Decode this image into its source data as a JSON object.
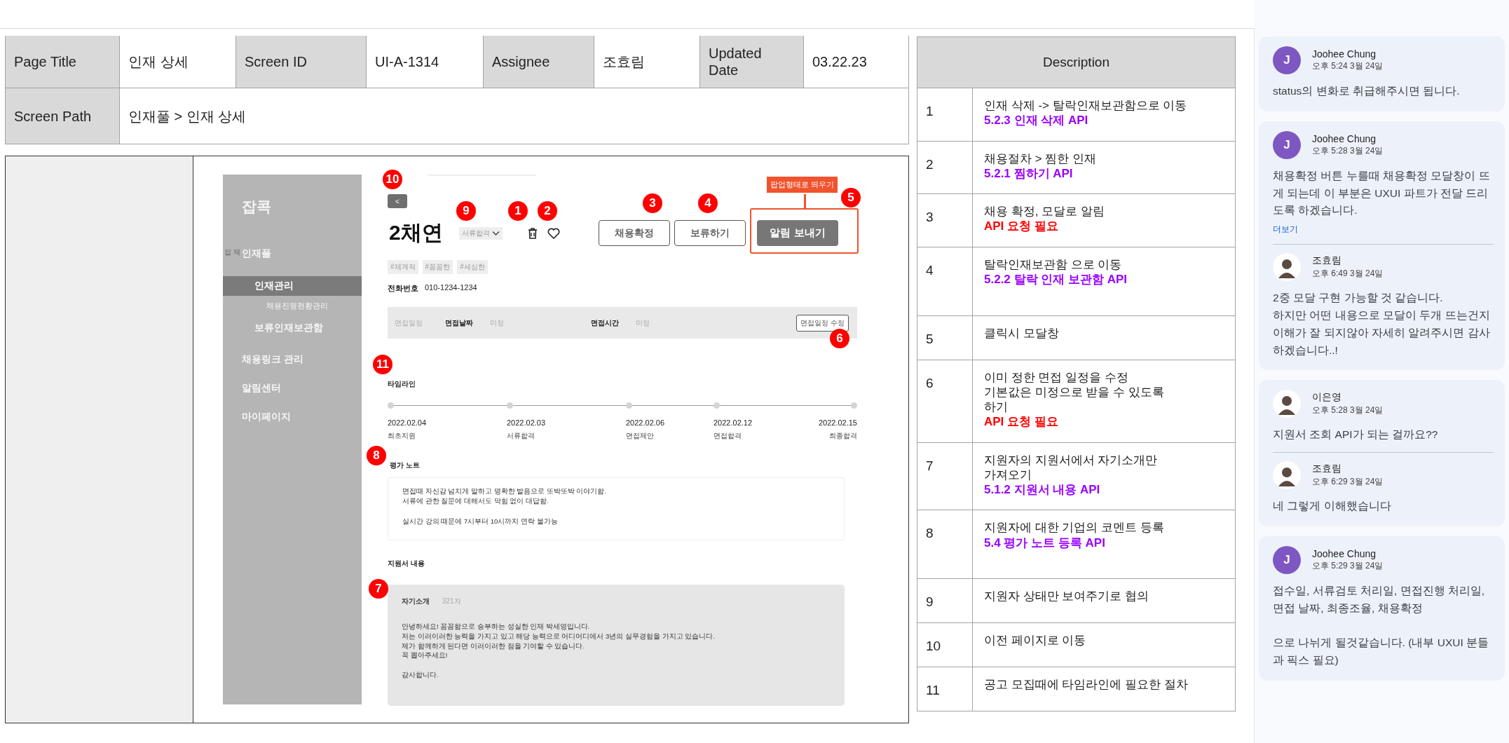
{
  "header": {
    "rows": [
      [
        {
          "label": "Page Title",
          "value": "인재 상세"
        },
        {
          "label": "Screen ID",
          "value": "UI-A-1314"
        },
        {
          "label": "Assignee",
          "value": "조효림"
        },
        {
          "label": "Updated Date",
          "value": "03.22.23"
        }
      ],
      [
        {
          "label": "Screen Path",
          "value": "인재풀 > 인재 상세"
        }
      ]
    ]
  },
  "wireframe": {
    "sidebar": {
      "logo": "잡콕",
      "ghost_text": "접 제",
      "items": [
        {
          "label": "인재풀",
          "selected": false,
          "children": [
            {
              "label": "인재관리",
              "selected": true,
              "children": [
                {
                  "label": "채용진행현황관리",
                  "selected": false
                }
              ]
            },
            {
              "label": "보류인재보관함",
              "selected": false
            }
          ]
        },
        {
          "label": "채용링크 관리",
          "selected": false
        },
        {
          "label": "알림센터",
          "selected": false
        },
        {
          "label": "마이페이지",
          "selected": false
        }
      ]
    },
    "back_button": "<",
    "name": "2채연",
    "status": "서류합격",
    "buttons": [
      {
        "label": "채용확정",
        "kind": "outline"
      },
      {
        "label": "보류하기",
        "kind": "outline"
      },
      {
        "label": "알림 보내기",
        "kind": "filled",
        "annotation": "팝업형태로 띄우기"
      }
    ],
    "tags": [
      "#체계적",
      "#꼼꼼한",
      "#세심한"
    ],
    "phone": {
      "label": "전화번호",
      "value": "010-1234-1234"
    },
    "interview": {
      "title": "면접일정",
      "fields": [
        {
          "label": "면접날짜",
          "value": "미정"
        },
        {
          "label": "면접시간",
          "value": "미정"
        }
      ],
      "edit_button": "면접일정 수정"
    },
    "timeline": {
      "title": "타임라인",
      "steps": [
        {
          "date": "2022.02.04",
          "label": "최초지원"
        },
        {
          "date": "2022.02.03",
          "label": "서류합격"
        },
        {
          "date": "2022.02.06",
          "label": "면접제안"
        },
        {
          "date": "2022.02.12",
          "label": "면접합격"
        },
        {
          "date": "2022.02.15",
          "label": "최종합격"
        }
      ]
    },
    "note": {
      "title": "평가 노트",
      "text": "면접때 자신감 넘치게 말하고 명확한 발음으로 또박또박 이야기함.\n서류에 관한 질문에 대해서도 막힘 없이 대답함.\n\n실시간 강의 때문에 7시부터 10시까지 연락 불가능"
    },
    "application": {
      "title": "지원서 내용",
      "section": "자기소개",
      "count": "321자",
      "text": "안녕하세요! 꼼꼼함으로 승부하는 성실한 인재 박세영입니다.\n저는 이러이러한 능력을 가지고 있고 해당 능력으로 어디어디에서 3년의 실무경험을 가지고 있습니다.\n제가 함께하게 된다면 이러이러한 점을 기여할 수 있습니다.\n꼭 뽑아주세요!\n\n감사합니다."
    },
    "markers": [
      "10",
      "9",
      "1",
      "2",
      "3",
      "4",
      "5",
      "6",
      "11",
      "8",
      "7"
    ]
  },
  "description": {
    "title": "Description",
    "rows": [
      {
        "number": "1",
        "lines": [
          {
            "kind": "plain",
            "text": "인재 삭제 -> 탈락인재보관함으로 이동"
          },
          {
            "kind": "api",
            "text": "5.2.3 인재 삭제 API"
          }
        ]
      },
      {
        "number": "2",
        "lines": [
          {
            "kind": "plain",
            "text": "채용절차 > 찜한 인재"
          },
          {
            "kind": "api",
            "text": "5.2.1 찜하기 API"
          }
        ]
      },
      {
        "number": "3",
        "lines": [
          {
            "kind": "plain",
            "text": "채용 확정, 모달로 알림"
          },
          {
            "kind": "request",
            "text": "API 요청 필요"
          }
        ]
      },
      {
        "number": "4",
        "lines": [
          {
            "kind": "plain",
            "text": "탈락인재보관함 으로 이동"
          },
          {
            "kind": "api",
            "text": "5.2.2 탈락 인재 보관함 API"
          }
        ]
      },
      {
        "number": "5",
        "lines": [
          {
            "kind": "plain",
            "text": "클릭시 모달창"
          }
        ]
      },
      {
        "number": "6",
        "lines": [
          {
            "kind": "plain",
            "text": "이미 정한 면접 일정을 수정"
          },
          {
            "kind": "plain",
            "text": "기본값은 미정으로 받을 수 있도록"
          },
          {
            "kind": "plain",
            "text": "하기"
          },
          {
            "kind": "request",
            "text": "API 요청 필요"
          }
        ]
      },
      {
        "number": "7",
        "lines": [
          {
            "kind": "plain",
            "text": "지원자의 지원서에서 자기소개만"
          },
          {
            "kind": "plain",
            "text": "가져오기"
          },
          {
            "kind": "api",
            "text": "5.1.2 지원서 내용 API"
          }
        ]
      },
      {
        "number": "8",
        "lines": [
          {
            "kind": "plain",
            "text": "지원자에 대한 기업의 코멘트 등록"
          },
          {
            "kind": "api",
            "text": "5.4 평가 노트 등록 API"
          }
        ]
      },
      {
        "number": "9",
        "lines": [
          {
            "kind": "plain",
            "text": "지원자 상태만 보여주기로 협의"
          }
        ]
      },
      {
        "number": "10",
        "lines": [
          {
            "kind": "plain",
            "text": "이전 페이지로 이동"
          }
        ]
      },
      {
        "number": "11",
        "lines": [
          {
            "kind": "plain",
            "text": "공고 모집때에 타임라인에 필요한 절차"
          }
        ]
      }
    ]
  },
  "comments": [
    {
      "items": [
        {
          "author": "Joohee Chung",
          "avatar": {
            "kind": "letter",
            "letter": "J"
          },
          "time": "오후 5:24 3월 24일",
          "text": "status의 변화로 취급해주시면 됩니다."
        }
      ]
    },
    {
      "items": [
        {
          "author": "Joohee Chung",
          "avatar": {
            "kind": "letter",
            "letter": "J"
          },
          "time": "오후 5:28 3월 24일",
          "text": "채용확정 버튼 누를때 채용확정 모달창이 뜨게 되는데 이 부분은  UXUI 파트가 전달 드리도록 하겠습니다.",
          "more": "더보기"
        },
        {
          "author": "조효림",
          "time": "오후 6:49 3월 24일",
          "text": "2중 모달 구현 가능할 것 같습니다.\n하지만 어떤 내용으로 모달이 두개 뜨는건지 이해가 잘 되지않아 자세히 알려주시면 감사하겠습니다..!"
        }
      ]
    },
    {
      "items": [
        {
          "author": "이은영",
          "time": "오후 5:28 3월 24일",
          "text": "지원서 조회 API가 되는 걸까요??"
        },
        {
          "author": "조효림",
          "time": "오후 6:29 3월 24일",
          "text": "네 그렇게 이해했습니다"
        }
      ]
    },
    {
      "items": [
        {
          "author": "Joohee Chung",
          "avatar": {
            "kind": "letter",
            "letter": "J"
          },
          "time": "오후 5:29 3월 24일",
          "text": "접수일, 서류검토 처리일, 면접진행 처리일, 면접 날짜, 최종조율, 채용확정\n\n으로 나뉘게 될것같습니다. (내부 UXUI 분들과 픽스 필요)"
        }
      ]
    }
  ]
}
